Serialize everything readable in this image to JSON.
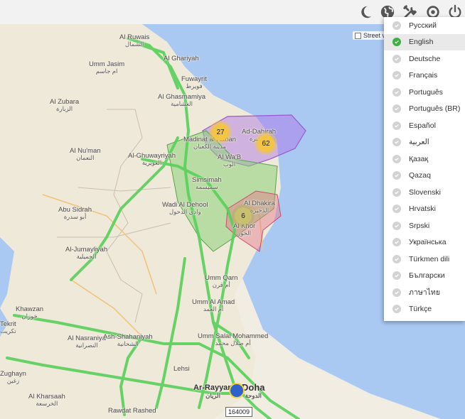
{
  "toolbar": {
    "icons": [
      "moon-icon",
      "globe-icon",
      "tools-icon",
      "settings-icon",
      "power-icon"
    ],
    "accent": "#555555"
  },
  "map": {
    "street_view_label": "Street view",
    "places": [
      {
        "name": "Al Ruwais",
        "ar": "الشمال"
      },
      {
        "name": "Umm Jasim",
        "ar": "ام جاسم"
      },
      {
        "name": "Al Ghariyah",
        "ar": ""
      },
      {
        "name": "Fuwayrit",
        "ar": "فويرط"
      },
      {
        "name": "Al Zubara",
        "ar": "الزبارة"
      },
      {
        "name": "Al Ghasmamiya",
        "ar": "الغشامية"
      },
      {
        "name": "Ad-Dahirah",
        "ar": "الذخيرة"
      },
      {
        "name": "Madinat al Kaban",
        "ar": "مدينة الكعبان"
      },
      {
        "name": "Al Nu'man",
        "ar": "النعمان"
      },
      {
        "name": "Al-Ghuwayriyah",
        "ar": "الغويرية"
      },
      {
        "name": "Al Wa'B",
        "ar": "الوب"
      },
      {
        "name": "Simsimah",
        "ar": "سميسمة"
      },
      {
        "name": "Abu Sidrah",
        "ar": "أبو سدرة"
      },
      {
        "name": "Wadi Al Dehool",
        "ar": "وادي الدحول"
      },
      {
        "name": "Al Dhakira",
        "ar": "الذخيرة"
      },
      {
        "name": "Al Khor",
        "ar": "الخور"
      },
      {
        "name": "Al-Jumayliyah",
        "ar": "الجميلية"
      },
      {
        "name": "Umm Qarn",
        "ar": "أم قرن"
      },
      {
        "name": "Khawzan",
        "ar": "خوزان"
      },
      {
        "name": "Umm Al Amad",
        "ar": "أم العمد"
      },
      {
        "name": "Al Nasraniya",
        "ar": "النصرانية"
      },
      {
        "name": "Ash-Shahaniyah",
        "ar": "الشحانية"
      },
      {
        "name": "Umm Salal Mohammed",
        "ar": "أم صلال محمد"
      },
      {
        "name": "Zughayn",
        "ar": "زغين"
      },
      {
        "name": "Al Kharsaah",
        "ar": "الخرسعة"
      },
      {
        "name": "Lehsi",
        "ar": ""
      },
      {
        "name": "Ar-Rayyan",
        "ar": "الريان"
      },
      {
        "name": "Doha",
        "ar": "الدوحة"
      },
      {
        "name": "Rawdat Rashed",
        "ar": ""
      },
      {
        "name": "Tekrit",
        "ar": "تكريت"
      }
    ],
    "clusters": [
      {
        "count": "27"
      },
      {
        "count": "62"
      },
      {
        "count": "6"
      }
    ],
    "vehicle_id": "164009"
  },
  "language_menu": {
    "selected": "English",
    "items": [
      "Русский",
      "English",
      "Deutsche",
      "Français",
      "Português",
      "Português (BR)",
      "Español",
      "العربية",
      "Қазақ",
      "Qazaq",
      "Slovenski",
      "Hrvatski",
      "Srpski",
      "Українська",
      "Türkmen dili",
      "Български",
      "ภาษาไทย",
      "Türkçe"
    ],
    "selected_color": "#3cb043"
  }
}
